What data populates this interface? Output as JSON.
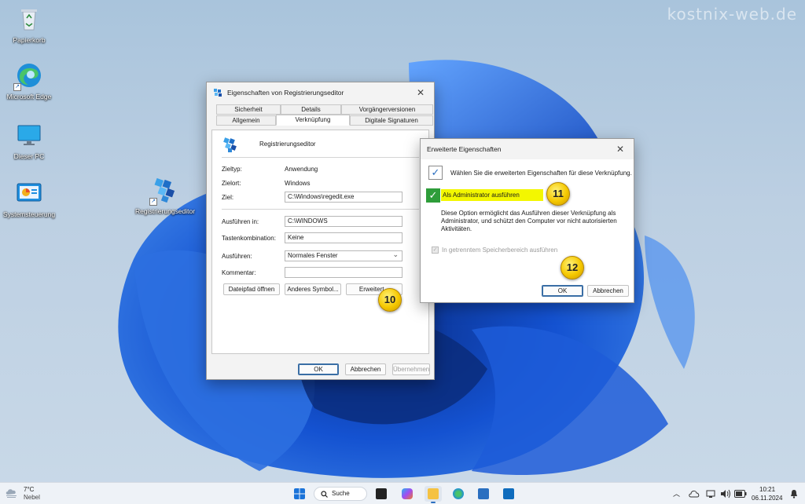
{
  "watermark": "kostnix-web.de",
  "desktop": {
    "icons": [
      {
        "label": "Papierkorb"
      },
      {
        "label": "Microsoft Edge"
      },
      {
        "label": "Dieser PC"
      },
      {
        "label": "Systemsteuerung"
      },
      {
        "label": "Registrierungseditor"
      }
    ]
  },
  "properties_window": {
    "title": "Eigenschaften von Registrierungseditor",
    "tabs_row1": [
      "Sicherheit",
      "Details",
      "Vorgängerversionen"
    ],
    "tabs_row2": [
      "Allgemein",
      "Verknüpfung",
      "Digitale Signaturen"
    ],
    "active_tab": "Verknüpfung",
    "app_name": "Registrierungseditor",
    "fields": {
      "zieltyp_label": "Zieltyp:",
      "zieltyp_value": "Anwendung",
      "zielort_label": "Zielort:",
      "zielort_value": "Windows",
      "ziel_label": "Ziel:",
      "ziel_value": "C:\\Windows\\regedit.exe",
      "ausfuehren_in_label": "Ausführen in:",
      "ausfuehren_in_value": "C:\\WINDOWS",
      "tasten_label": "Tastenkombination:",
      "tasten_value": "Keine",
      "ausfuehren_label": "Ausführen:",
      "ausfuehren_value": "Normales Fenster",
      "kommentar_label": "Kommentar:",
      "kommentar_value": ""
    },
    "buttons": {
      "dateipfad": "Dateipfad öffnen",
      "symbol": "Anderes Symbol...",
      "erweitert": "Erweitert...",
      "ok": "OK",
      "abbrechen": "Abbrechen",
      "uebernehmen": "Übernehmen"
    },
    "badge": "10"
  },
  "advanced_dialog": {
    "title": "Erweiterte Eigenschaften",
    "intro": "Wählen Sie die erweiterten Eigenschaften für diese Verknüpfung.",
    "admin_label": "Als Administrator ausführen",
    "admin_checked": true,
    "description": "Diese Option ermöglicht das Ausführen dieser Verknüpfung als Administrator, und schützt den Computer vor nicht autorisierten Aktivitäten.",
    "separate_memory_label": "In getrenntem Speicherbereich ausführen",
    "ok": "OK",
    "abbrechen": "Abbrechen",
    "badge_admin": "11",
    "badge_ok": "12",
    "highlight_color": "#f3f700"
  },
  "taskbar": {
    "weather_temp": "7°C",
    "weather_text": "Nebel",
    "search_label": "Suche",
    "time": "10:21",
    "date": "06.11.2024"
  }
}
